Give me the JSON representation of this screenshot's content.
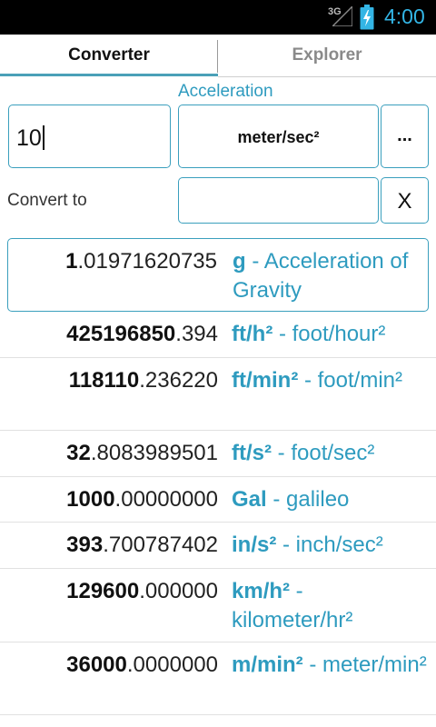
{
  "status_bar": {
    "network": "3G",
    "time": "4:00"
  },
  "tabs": [
    {
      "label": "Converter",
      "active": true
    },
    {
      "label": "Explorer",
      "active": false
    }
  ],
  "category": "Acceleration",
  "input": {
    "value": "10"
  },
  "from_unit": "meter/sec²",
  "more_button": "...",
  "convert_to_label": "Convert to",
  "to_unit_value": "",
  "clear_button": "X",
  "results": [
    {
      "int": "1",
      "frac": ".01971620735",
      "symbol": "g",
      "sep": " - ",
      "name": "Acceleration of Gravity",
      "selected": true
    },
    {
      "int": "425196850",
      "frac": ".394",
      "symbol": "ft/h²",
      "sep": " - ",
      "name": "foot/hour²"
    },
    {
      "int": "118110",
      "frac": ".236220",
      "symbol": "ft/min²",
      "sep": " - ",
      "name": "foot/min²"
    },
    {
      "int": "32",
      "frac": ".8083989501",
      "symbol": "ft/s²",
      "sep": " - ",
      "name": "foot/sec²"
    },
    {
      "int": "1000",
      "frac": ".00000000",
      "symbol": "Gal",
      "sep": " - ",
      "name": "galileo"
    },
    {
      "int": "393",
      "frac": ".700787402",
      "symbol": "in/s²",
      "sep": " - ",
      "name": "inch/sec²"
    },
    {
      "int": "129600",
      "frac": ".000000",
      "symbol": "km/h²",
      "sep": " - ",
      "name": "kilometer/hr²"
    },
    {
      "int": "36000",
      "frac": ".0000000",
      "symbol": "m/min²",
      "sep": " - ",
      "name": "meter/min²"
    }
  ],
  "colors": {
    "accent": "#33b5e5",
    "link": "#2e9bbf",
    "border": "#3a9fbd"
  }
}
